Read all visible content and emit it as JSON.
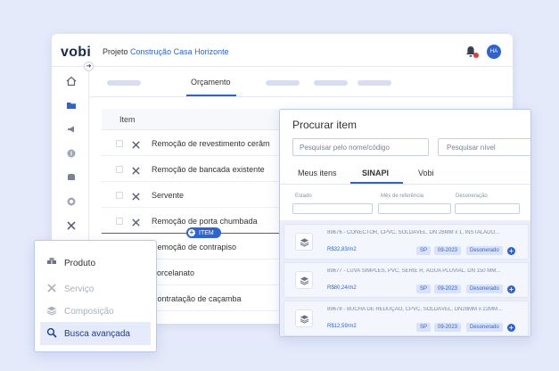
{
  "app": {
    "logo": "vobi",
    "project_label": "Projeto",
    "project_name": "Construção Casa Horizonte",
    "avatar_initials": "HA"
  },
  "tabs": {
    "active_label": "Orçamento"
  },
  "table": {
    "header": "Item",
    "rows": [
      {
        "label": "Remoção de revestimento cerâm"
      },
      {
        "label": "Remoção de bancada existente"
      },
      {
        "label": "Servente"
      },
      {
        "label": "Remoção de porta chumbada"
      },
      {
        "label": "Remoção de contrapiso"
      },
      {
        "label": "Porcelanato"
      },
      {
        "label": "Contratação de caçamba"
      }
    ],
    "insert_label": "ITEM"
  },
  "search_panel": {
    "title": "Procurar item",
    "search_placeholder": "Pesquisar pelo nome/código",
    "level_placeholder": "Pesquisar nível",
    "tabs": [
      "Meus itens",
      "SINAPI",
      "Vobi"
    ],
    "active_tab": "SINAPI",
    "filters": [
      "Estado",
      "Mês de referência",
      "Desoneração"
    ],
    "results": [
      {
        "desc": "89676 - CONECTOR, CPVC, SOLDÁVEL, DN 28MM x 1, INSTALADO...",
        "price": "R$32,83/m2",
        "state": "SP",
        "date": "09-2023",
        "tag": "Desonerado"
      },
      {
        "desc": "89677 - LUVA SIMPLES, PVC, SERIE R, ÁGUA PLUVIAL, DN 150 MM...",
        "price": "R$80,24/m2",
        "state": "SP",
        "date": "09-2023",
        "tag": "Desonerado"
      },
      {
        "desc": "89678 - BUCHA DE REDUÇÃO, CPVC, SOLDÁVEL, DN28MM x 22MM...",
        "price": "R$12,59/m2",
        "state": "SP",
        "date": "09-2023",
        "tag": "Desonerado"
      }
    ]
  },
  "add_menu": {
    "items": [
      {
        "label": "Produto",
        "icon": "boxes-icon",
        "state": "normal"
      },
      {
        "label": "Serviço",
        "icon": "tools-icon",
        "state": "dim"
      },
      {
        "label": "Composição",
        "icon": "layers-icon",
        "state": "dim"
      },
      {
        "label": "Busca avançada",
        "icon": "search-icon",
        "state": "active"
      }
    ]
  },
  "colors": {
    "accent": "#2d64d2",
    "background": "#e5eafa",
    "notification": "#e53a3a"
  }
}
